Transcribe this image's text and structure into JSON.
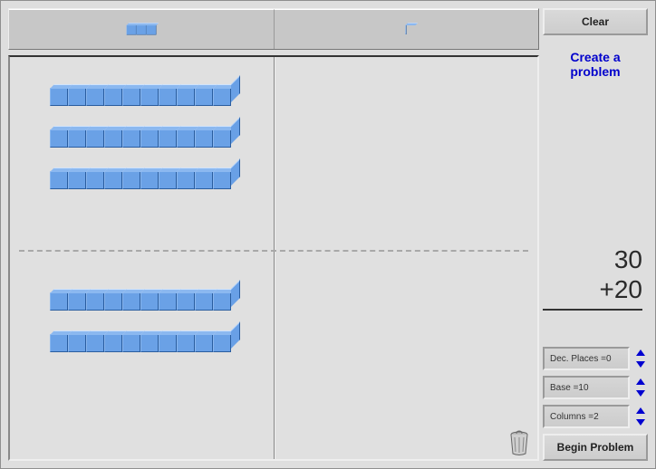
{
  "columns": {
    "tens_label": "tens-rod-icon",
    "ones_label": "unit-cube-icon"
  },
  "workspace": {
    "divider_percent": 48,
    "top_rods": 3,
    "bottom_rods": 2,
    "top_units": 0,
    "bottom_units": 0
  },
  "sidebar": {
    "clear_label": "Clear",
    "instruction": "Create a\nproblem",
    "equation": {
      "operand1": "30",
      "operator": "+",
      "operand2": "20"
    },
    "settings": {
      "dec_label": "Dec. Places = ",
      "dec_value": "0",
      "base_label": "Base = ",
      "base_value": "10",
      "cols_label": "Columns = ",
      "cols_value": "2"
    },
    "begin_label": "Begin Problem"
  }
}
